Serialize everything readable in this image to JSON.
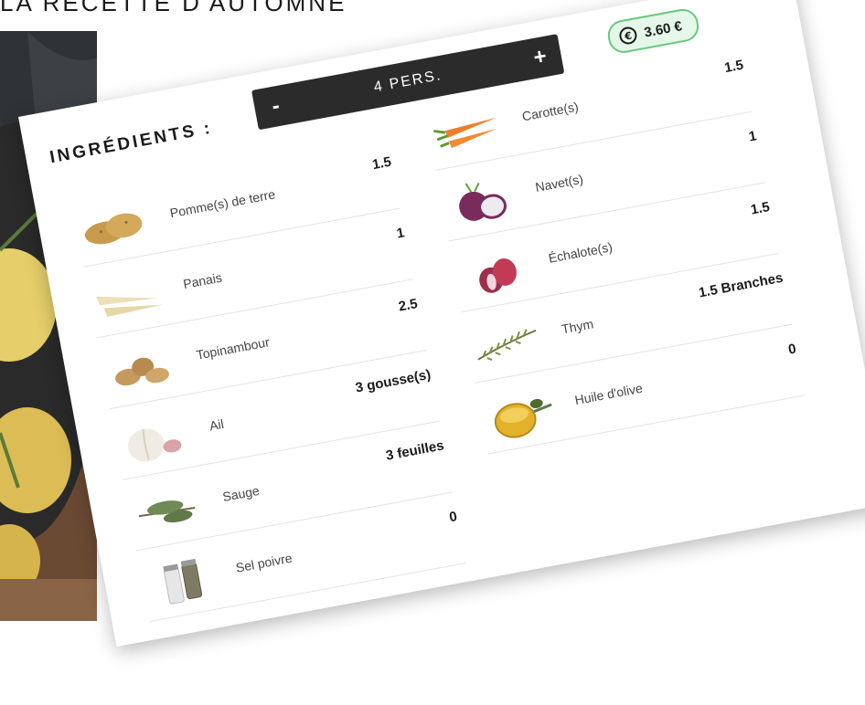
{
  "page": {
    "heading": "LA RECETTE D'AUTOMNE"
  },
  "card": {
    "ingredients_title": "INGRÉDIENTS :",
    "servings": {
      "minus_label": "-",
      "count_label": "4 PERS.",
      "plus_label": "+"
    },
    "price": {
      "icon": "euro-coin-icon",
      "value": "3.60 €",
      "accent_color": "#66c97e"
    },
    "left_column": [
      {
        "name": "Pomme(s) de terre",
        "qty": "1.5",
        "icon": "potato-icon"
      },
      {
        "name": "Panais",
        "qty": "1",
        "icon": "parsnip-icon"
      },
      {
        "name": "Topinambour",
        "qty": "2.5",
        "icon": "jerusalem-artichoke-icon"
      },
      {
        "name": "Ail",
        "qty": "3 gousse(s)",
        "icon": "garlic-icon"
      },
      {
        "name": "Sauge",
        "qty": "3 feuilles",
        "icon": "sage-leaf-icon"
      },
      {
        "name": "Sel poivre",
        "qty": "0",
        "icon": "salt-pepper-icon"
      }
    ],
    "right_column": [
      {
        "name": "Carotte(s)",
        "qty": "1.5",
        "icon": "carrot-icon"
      },
      {
        "name": "Navet(s)",
        "qty": "1",
        "icon": "turnip-icon"
      },
      {
        "name": "Échalote(s)",
        "qty": "1.5",
        "icon": "shallot-icon"
      },
      {
        "name": "Thym",
        "qty": "1.5 Branches",
        "icon": "thyme-icon"
      },
      {
        "name": "Huile d'olive",
        "qty": "0",
        "icon": "olive-oil-icon"
      }
    ]
  }
}
